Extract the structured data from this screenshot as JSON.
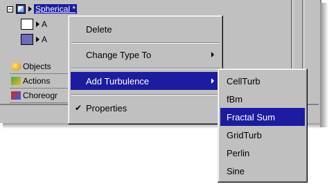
{
  "tree": {
    "expander": "⊟",
    "selected_item": "Spherical *",
    "child1_label": "A",
    "child2_label": "A"
  },
  "tabs": [
    {
      "label": "Objects",
      "icon": "objects-icon"
    },
    {
      "label": "Actions",
      "icon": "actions-icon"
    },
    {
      "label": "Choreogr",
      "icon": "choreography-icon"
    }
  ],
  "context_menu": {
    "delete": "Delete",
    "change_type": "Change Type To",
    "add_turbulence": "Add Turbulence",
    "properties": "Properties",
    "check": "✔"
  },
  "turbulence_submenu": {
    "items": [
      "CellTurb",
      "fBm",
      "Fractal Sum",
      "GridTurb",
      "Perlin",
      "Sine"
    ],
    "highlighted": "Fractal Sum"
  },
  "colors": {
    "selection": "#1c1ca0",
    "panel": "#c0c0c0"
  }
}
